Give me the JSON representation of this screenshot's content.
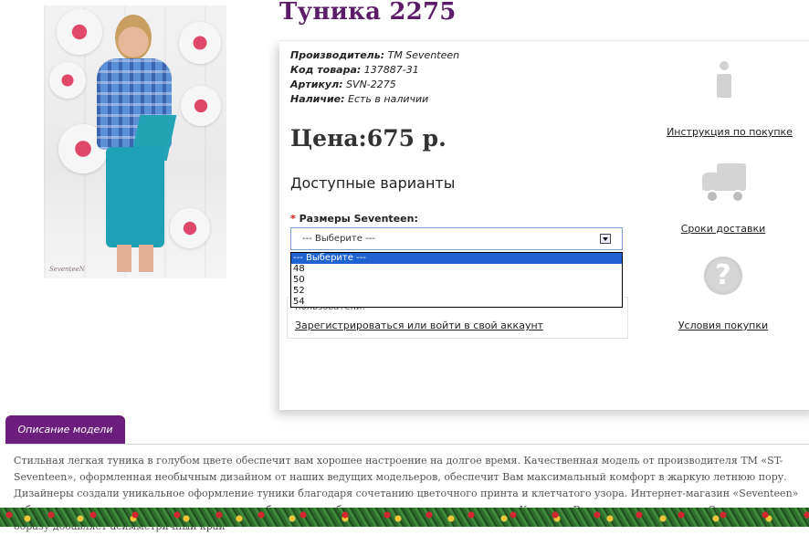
{
  "product": {
    "title": "Туника 2275",
    "manufacturer_label": "Производитель:",
    "manufacturer": "TM Seventeen",
    "code_label": "Код товара:",
    "code": "137887-31",
    "sku_label": "Артикул:",
    "sku": "SVN-2275",
    "availability_label": "Наличие:",
    "availability": "Есть в наличии",
    "price_label": "Цена:",
    "price": "675 р.",
    "photo_signature": "SeventeeN"
  },
  "options": {
    "heading": "Доступные варианты",
    "required_mark": "*",
    "size_label": "Размеры Seventeen:",
    "select_value": "--- Выберите ---",
    "dropdown": [
      "--- Выберите ---",
      "48",
      "50",
      "52",
      "54"
    ]
  },
  "login": {
    "tail_text": "пользователи!",
    "link": "Зарегистрироваться или войти в свой аккаунт"
  },
  "sidebar": {
    "items": [
      {
        "label": "Инструкция по покупке",
        "icon": "info-icon"
      },
      {
        "label": "Сроки доставки",
        "icon": "truck-icon"
      },
      {
        "label": "Условия покупки",
        "icon": "question-icon"
      }
    ]
  },
  "description": {
    "tab_label": "Описание модели",
    "text": "Стильная легкая туника в голубом цвете обеспечит вам хорошее настроение на долгое время. Качественная модель от производителя ТМ «ST-Seventeen», оформленная необычным дизайном от наших ведущих модельеров, обеспечит Вам максимальный комфорт в жаркую летнюю пору. Дизайнеры создали уникальное оформление туники благодаря сочетанию цветочного принта и клетчатого узора. Интернет-магазин «Seventeen» заботится о красоте своих клиентов, поэтому обеспечивает быструю доставку во все регионы Украины, России и другие страны. Оригинальности образу добавляет асимметричный край"
  },
  "colors": {
    "title": "#5c1d68",
    "tab": "#6b1e7e",
    "dropdown_selected": "#1e63d0"
  }
}
